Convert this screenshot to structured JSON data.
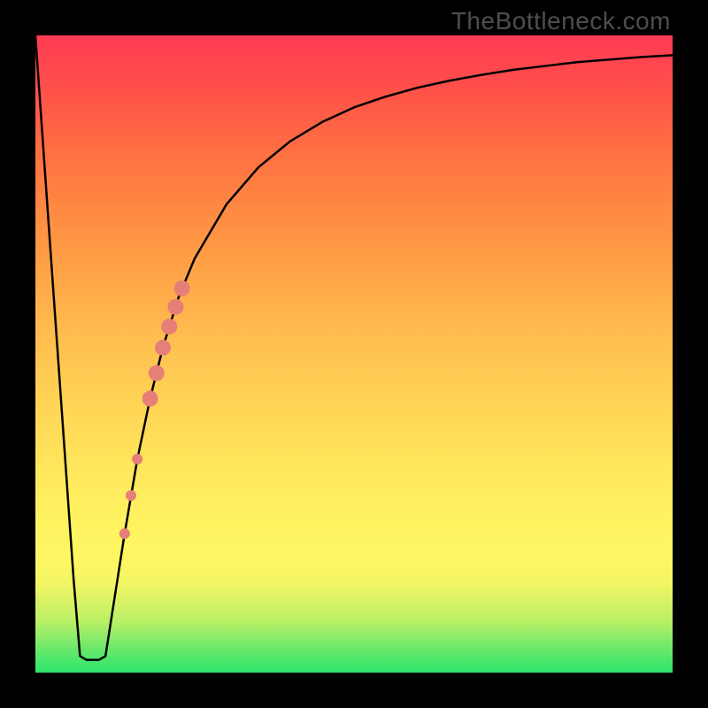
{
  "watermark": "TheBottleneck.com",
  "chart_data": {
    "type": "line",
    "title": "",
    "xlabel": "",
    "ylabel": "",
    "xlim": [
      0,
      100
    ],
    "ylim": [
      0,
      100
    ],
    "grid": false,
    "series": [
      {
        "name": "curve",
        "x": [
          0.0,
          2.0,
          4.0,
          6.0,
          7.0,
          8.0,
          9.0,
          10.0,
          11.0,
          12.0,
          14.0,
          16.0,
          18.0,
          20.0,
          22.5,
          25.0,
          30.0,
          35.0,
          40.0,
          45.0,
          50.0,
          55.0,
          60.0,
          65.0,
          70.0,
          75.0,
          80.0,
          85.0,
          90.0,
          95.0,
          100.0
        ],
        "y": [
          100.0,
          71.5,
          43.1,
          14.6,
          2.6,
          2.0,
          2.0,
          2.0,
          2.6,
          9.0,
          21.8,
          33.5,
          43.0,
          51.0,
          59.0,
          65.0,
          73.5,
          79.3,
          83.4,
          86.4,
          88.7,
          90.4,
          91.8,
          92.9,
          93.8,
          94.6,
          95.2,
          95.8,
          96.2,
          96.6,
          96.9
        ]
      }
    ],
    "markers": [
      {
        "x": 14.0,
        "y": 21.8,
        "r": 6,
        "color": "#e57f78"
      },
      {
        "x": 15.0,
        "y": 27.8,
        "r": 6,
        "color": "#e57f78"
      },
      {
        "x": 16.0,
        "y": 33.5,
        "r": 6,
        "color": "#e57f78"
      },
      {
        "x": 18.0,
        "y": 43.0,
        "r": 9,
        "color": "#e57f78"
      },
      {
        "x": 19.0,
        "y": 47.0,
        "r": 9,
        "color": "#e57f78"
      },
      {
        "x": 20.0,
        "y": 51.0,
        "r": 9,
        "color": "#e57f78"
      },
      {
        "x": 21.0,
        "y": 54.3,
        "r": 9,
        "color": "#e57f78"
      },
      {
        "x": 22.0,
        "y": 57.4,
        "r": 9,
        "color": "#e57f78"
      },
      {
        "x": 23.0,
        "y": 60.3,
        "r": 9,
        "color": "#e57f78"
      }
    ]
  }
}
